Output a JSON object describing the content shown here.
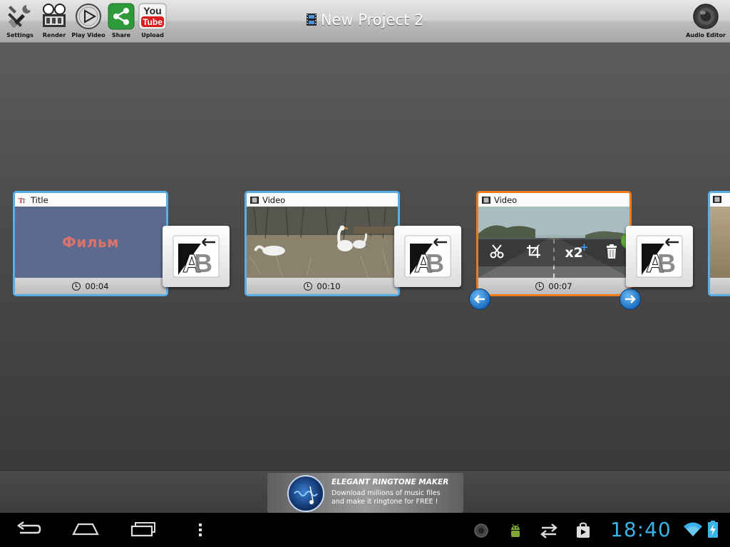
{
  "toolbar": {
    "items": [
      {
        "label": "Settings",
        "icon": "settings-tools-icon"
      },
      {
        "label": "Render",
        "icon": "render-projector-icon"
      },
      {
        "label": "Play Video",
        "icon": "play-video-icon"
      },
      {
        "label": "Share",
        "icon": "share-icon"
      },
      {
        "label": "Upload",
        "icon": "youtube-upload-icon"
      }
    ],
    "youtube_you": "You",
    "youtube_tube": "Tube",
    "project_title": "New Project 2",
    "audio_editor_label": "Audio Editor"
  },
  "timeline": {
    "clips": [
      {
        "type_label": "Title",
        "thumb_text": "Фильм",
        "duration": "00:04",
        "selected": false
      },
      {
        "type_label": "Video",
        "duration": "00:10",
        "selected": false
      },
      {
        "type_label": "Video",
        "duration": "00:07",
        "selected": true,
        "speed_label": "x2"
      }
    ],
    "transition_icon": "ab-transition-icon"
  },
  "ad": {
    "title": "ELEGANT RINGTONE MAKER",
    "line1": "Download millions of music files",
    "line2": "and make it ringtone for FREE !"
  },
  "system_bar": {
    "time": "18:40"
  },
  "colors": {
    "selected_border": "#ee7b1e",
    "clip_border": "#58aee6",
    "clock_text": "#39b2e6",
    "share_green": "#2e9a3a",
    "youtube_red": "#d81f1f"
  }
}
